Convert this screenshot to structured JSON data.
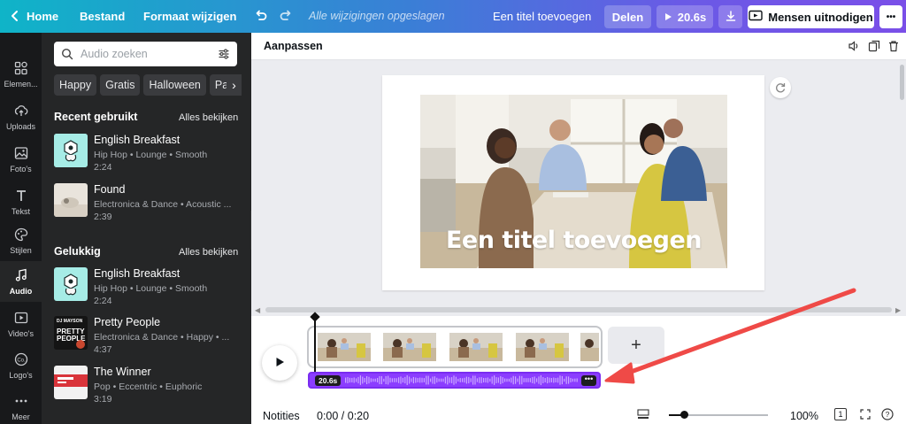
{
  "topbar": {
    "home_label": "Home",
    "file_label": "Bestand",
    "resize_label": "Formaat wijzigen",
    "saved_status": "Alle wijzigingen opgeslagen",
    "design_title": "Een titel toevoegen",
    "share_label": "Delen",
    "play_duration": "20.6s",
    "invite_label": "Mensen uitnodigen",
    "more_label": "•••"
  },
  "rail": {
    "items": [
      {
        "label": "Elemen...",
        "icon": "elements-icon"
      },
      {
        "label": "Uploads",
        "icon": "upload-icon"
      },
      {
        "label": "Foto's",
        "icon": "photo-icon"
      },
      {
        "label": "Tekst",
        "icon": "text-icon"
      },
      {
        "label": "Stijlen",
        "icon": "palette-icon"
      },
      {
        "label": "Audio",
        "icon": "music-icon"
      },
      {
        "label": "Video's",
        "icon": "video-icon"
      },
      {
        "label": "Logo's",
        "icon": "logo-icon"
      },
      {
        "label": "Meer",
        "icon": "more-icon"
      }
    ]
  },
  "panel": {
    "search_placeholder": "Audio zoeken",
    "chips": [
      "Happy",
      "Gratis",
      "Halloween",
      "Party"
    ],
    "recent": {
      "title": "Recent gebruikt",
      "see_all": "Alles bekijken",
      "tracks": [
        {
          "title": "English Breakfast",
          "meta": "Hip Hop • Lounge • Smooth",
          "duration": "2:24"
        },
        {
          "title": "Found",
          "meta": "Electronica & Dance • Acoustic ...",
          "duration": "2:39"
        }
      ]
    },
    "happy": {
      "title": "Gelukkig",
      "see_all": "Alles bekijken",
      "tracks": [
        {
          "title": "English Breakfast",
          "meta": "Hip Hop • Lounge • Smooth",
          "duration": "2:24"
        },
        {
          "title": "Pretty People",
          "meta": "Electronica & Dance • Happy • ...",
          "duration": "4:37"
        },
        {
          "title": "The Winner",
          "meta": "Pop • Eccentric • Euphoric",
          "duration": "3:19"
        }
      ],
      "pretty_people_cover_lines": [
        "DJ MAYSON",
        "PRETTY",
        "PEOPLE"
      ]
    }
  },
  "editor": {
    "toolbar_label": "Aanpassen",
    "page_title": "Een titel toevoegen",
    "audio_badge": "20.6s",
    "audio_more": "•••",
    "add_clip": "+",
    "footer": {
      "notes": "Notities",
      "time": "0:00 / 0:20",
      "zoom": "100%",
      "page_num": "1"
    },
    "zoom_level": 0.15
  },
  "colors": {
    "brand_gradient_start": "#0fb4c8",
    "brand_gradient_end": "#7a4fe8",
    "audio_track": "#8b3dff",
    "annotation_arrow": "#ef4a47"
  }
}
